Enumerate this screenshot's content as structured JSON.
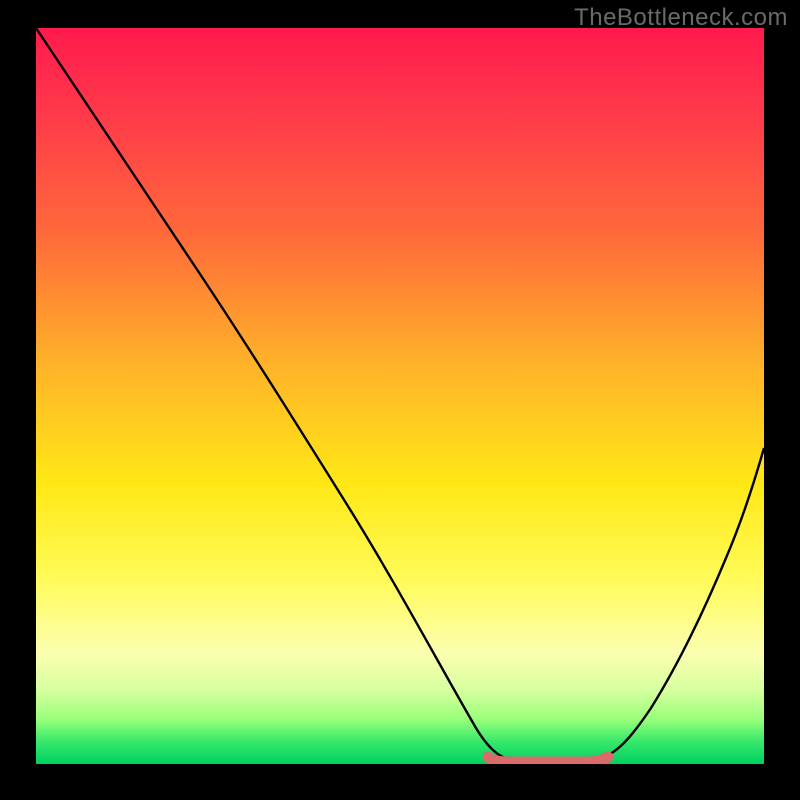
{
  "watermark": {
    "text": "TheBottleneck.com"
  },
  "chart_data": {
    "type": "line",
    "title": "",
    "xlabel": "",
    "ylabel": "",
    "xlim": [
      0,
      100
    ],
    "ylim": [
      0,
      100
    ],
    "series": [
      {
        "name": "bottleneck-curve",
        "x": [
          0,
          5,
          10,
          15,
          20,
          25,
          30,
          35,
          40,
          45,
          50,
          55,
          58,
          62,
          66,
          70,
          74,
          78,
          82,
          86,
          90,
          95,
          100
        ],
        "y": [
          100,
          92,
          84,
          76,
          68,
          60,
          52,
          44,
          37,
          29,
          21,
          13,
          6,
          1,
          0,
          0,
          0,
          1,
          6,
          14,
          24,
          38,
          55
        ]
      }
    ],
    "highlight_segment": {
      "name": "optimal-range",
      "x_start": 62,
      "x_end": 78,
      "y": 0.4
    },
    "background_gradient": {
      "stops": [
        {
          "pos": 0,
          "color": "#ff1a4d"
        },
        {
          "pos": 28,
          "color": "#ff6a3a"
        },
        {
          "pos": 62,
          "color": "#ffe816"
        },
        {
          "pos": 90,
          "color": "#d6ff9e"
        },
        {
          "pos": 100,
          "color": "#00d060"
        }
      ]
    }
  }
}
